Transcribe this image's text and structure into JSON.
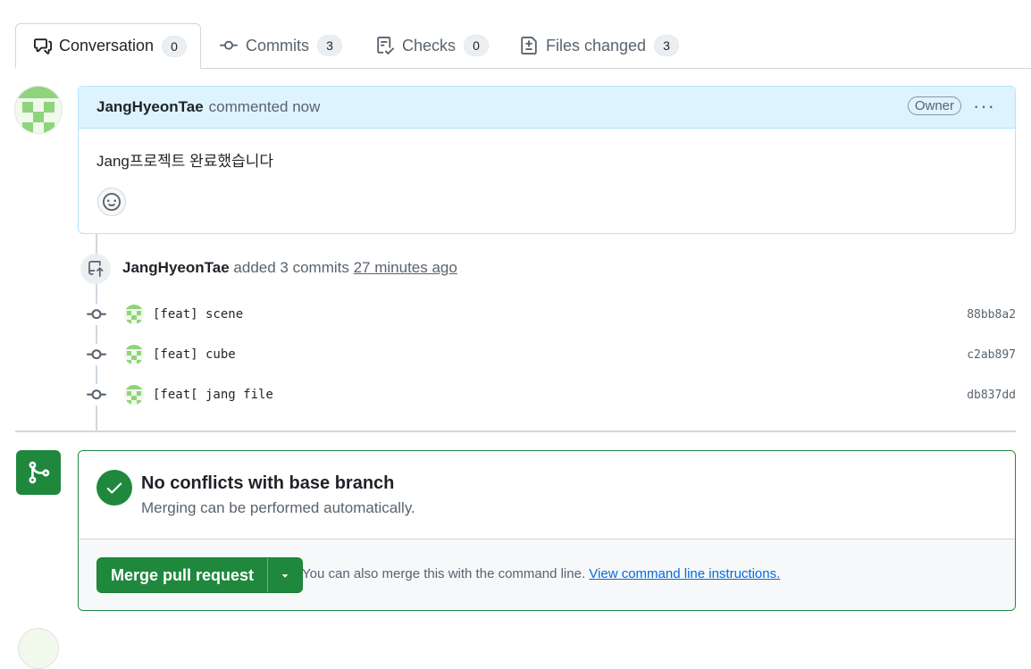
{
  "tabs": [
    {
      "label": "Conversation",
      "count": "0",
      "icon": "comment-discussion-icon",
      "active": true
    },
    {
      "label": "Commits",
      "count": "3",
      "icon": "git-commit-icon"
    },
    {
      "label": "Checks",
      "count": "0",
      "icon": "checklist-icon"
    },
    {
      "label": "Files changed",
      "count": "3",
      "icon": "file-diff-icon"
    }
  ],
  "comment": {
    "author": "JangHyeonTae",
    "meta": "commented now",
    "badge": "Owner",
    "menu": "···",
    "body": "Jang프로젝트 완료했습니다"
  },
  "push": {
    "author": "JangHyeonTae",
    "text": "added 3 commits",
    "time": "27 minutes ago"
  },
  "commits": [
    {
      "message": "[feat] scene",
      "sha": "88bb8a2"
    },
    {
      "message": "[feat] cube",
      "sha": "c2ab897"
    },
    {
      "message": "[feat[ jang file",
      "sha": "db837dd"
    }
  ],
  "merge": {
    "title": "No conflicts with base branch",
    "subtitle": "Merging can be performed automatically.",
    "button": "Merge pull request",
    "hint": "You can also merge this with the command line.",
    "link": "View command line instructions."
  },
  "colors": {
    "accent_green": "#1f883d",
    "link_blue": "#0969da",
    "comment_header_bg": "#ddf4ff"
  }
}
